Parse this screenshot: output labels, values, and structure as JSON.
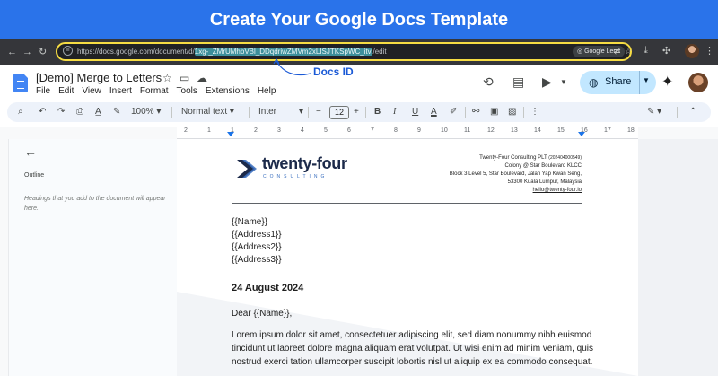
{
  "banner": {
    "title": "Create Your Google Docs Template"
  },
  "browser": {
    "url_prefix": "https://docs.google.com/document/d/",
    "url_id": "1xg-_ZMrUMhbVBl_DDqdriwZMVm2xLISJTKSpWC_itvl",
    "url_suffix": "/edit",
    "lens_label": "Google Lens",
    "callout": "Docs ID",
    "icons": [
      "back-icon",
      "forward-icon",
      "reload-icon",
      "site-info-icon",
      "google-lens-icon",
      "translate-icon",
      "bookmark-star-icon",
      "extension-icon",
      "sidebar-icon",
      "profile-icon"
    ]
  },
  "docs": {
    "title": "[Demo] Merge to Letters",
    "menu": [
      "File",
      "Edit",
      "View",
      "Insert",
      "Format",
      "Tools",
      "Extensions",
      "Help"
    ],
    "share_label": "Share"
  },
  "toolbar": {
    "zoom": "100%",
    "style": "Normal text",
    "font": "Inter",
    "font_size": "12",
    "minus": "−",
    "plus": "+",
    "bold": "B",
    "italic": "I",
    "underline": "U",
    "text_color": "A"
  },
  "ruler": {
    "numbers": [
      "2",
      "1",
      "1",
      "2",
      "3",
      "4",
      "5",
      "6",
      "7",
      "8",
      "9",
      "10",
      "11",
      "12",
      "13",
      "14",
      "15",
      "16",
      "17",
      "18"
    ]
  },
  "outline": {
    "label": "Outline",
    "hint": "Headings that you add to the document will appear here."
  },
  "letter": {
    "brand_name": "twenty-four",
    "brand_sub": "CONSULTING",
    "company": "Twenty-Four Consulting PLT",
    "company_reg": "(202404000549)",
    "address1": "Colony @ Star Boulevard KLCC",
    "address2": "Block 3 Level 5, Star Boulevard,  Jalan Yap Kwan Seng,",
    "address3": "53300 Kuala Lumpur, Malaysia",
    "email": "hello@twenty-four.io",
    "fields": [
      "{{Name}}",
      "{{Address1}}",
      "{{Address2}}",
      "{{Address3}}"
    ],
    "date": "24 August 2024",
    "salutation": "Dear {{Name}},",
    "body": "Lorem ipsum dolor sit amet, consectetuer adipiscing elit, sed diam nonummy nibh euismod tincidunt ut laoreet dolore magna aliquam erat volutpat. Ut wisi enim ad minim veniam, quis nostrud exerci tation ullamcorper suscipit lobortis nisl ut aliquip ex ea commodo consequat."
  },
  "colors": {
    "banner": "#2a73ea",
    "callout": "#1a59d6",
    "highlight": "#3d8f9b",
    "share": "#c2e7ff"
  }
}
